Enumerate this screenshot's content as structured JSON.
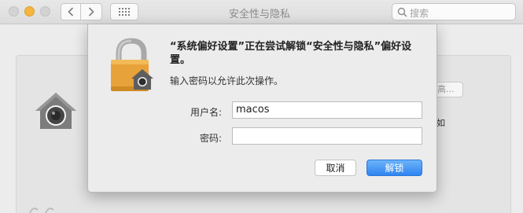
{
  "window": {
    "title": "安全性与隐私"
  },
  "search": {
    "placeholder": "搜索"
  },
  "background": {
    "button_label": "高...",
    "text_fragment": "如"
  },
  "dialog": {
    "message": "“系统偏好设置”正在尝试解锁“安全性与隐私”偏好设置。",
    "sub_message": "输入密码以允许此次操作。",
    "username_label": "用户名:",
    "username_value": "macos",
    "password_label": "密码:",
    "password_value": "",
    "cancel_label": "取消",
    "unlock_label": "解锁"
  },
  "colors": {
    "accent": "#2f84ef",
    "lock_gold": "#e8a23a"
  }
}
